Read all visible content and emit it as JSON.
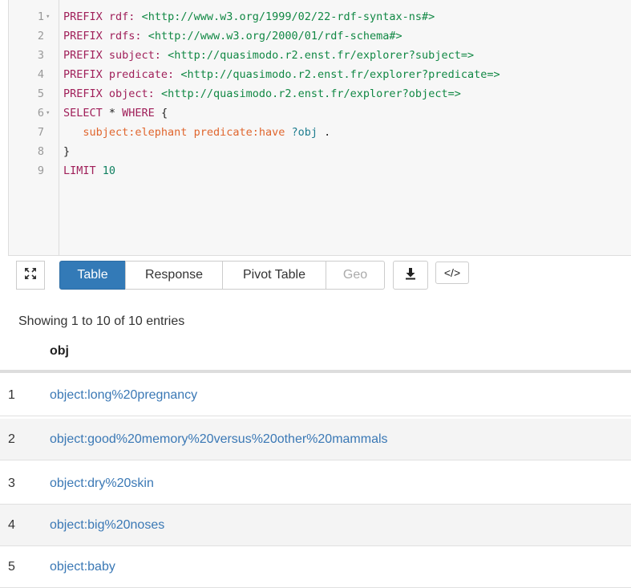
{
  "editor": {
    "lines": [
      {
        "n": "1",
        "fold": true,
        "parts": [
          [
            "kw",
            "PREFIX "
          ],
          [
            "pfx",
            "rdf:"
          ],
          [
            "br",
            " "
          ],
          [
            "iri",
            "<http://www.w3.org/1999/02/22-rdf-syntax-ns#>"
          ]
        ]
      },
      {
        "n": "2",
        "fold": false,
        "parts": [
          [
            "kw",
            "PREFIX "
          ],
          [
            "pfx",
            "rdfs:"
          ],
          [
            "br",
            " "
          ],
          [
            "iri",
            "<http://www.w3.org/2000/01/rdf-schema#>"
          ]
        ]
      },
      {
        "n": "3",
        "fold": false,
        "parts": [
          [
            "kw",
            "PREFIX "
          ],
          [
            "pfx",
            "subject:"
          ],
          [
            "br",
            " "
          ],
          [
            "iri",
            "<http://quasimodo.r2.enst.fr/explorer?subject=>"
          ]
        ]
      },
      {
        "n": "4",
        "fold": false,
        "parts": [
          [
            "kw",
            "PREFIX "
          ],
          [
            "pfx",
            "predicate:"
          ],
          [
            "br",
            " "
          ],
          [
            "iri",
            "<http://quasimodo.r2.enst.fr/explorer?predicate=>"
          ]
        ]
      },
      {
        "n": "5",
        "fold": false,
        "parts": [
          [
            "kw",
            "PREFIX "
          ],
          [
            "pfx",
            "object:"
          ],
          [
            "br",
            " "
          ],
          [
            "iri",
            "<http://quasimodo.r2.enst.fr/explorer?object=>"
          ]
        ]
      },
      {
        "n": "6",
        "fold": true,
        "parts": [
          [
            "kw",
            "SELECT "
          ],
          [
            "br",
            "* "
          ],
          [
            "kw",
            "WHERE "
          ],
          [
            "br",
            "{"
          ]
        ]
      },
      {
        "n": "7",
        "fold": false,
        "parts": [
          [
            "br",
            "   "
          ],
          [
            "name",
            "subject:elephant"
          ],
          [
            "br",
            " "
          ],
          [
            "name",
            "predicate:have"
          ],
          [
            "br",
            " "
          ],
          [
            "var",
            "?obj"
          ],
          [
            "br",
            " ."
          ]
        ]
      },
      {
        "n": "8",
        "fold": false,
        "parts": [
          [
            "br",
            "}"
          ]
        ]
      },
      {
        "n": "9",
        "fold": false,
        "parts": [
          [
            "kw",
            "LIMIT "
          ],
          [
            "num",
            "10"
          ]
        ]
      }
    ]
  },
  "toolbar": {
    "expand_icon": "expand-icon",
    "tabs": [
      {
        "id": "table",
        "label": "Table",
        "active": true,
        "disabled": false
      },
      {
        "id": "response",
        "label": "Response",
        "active": false,
        "disabled": false
      },
      {
        "id": "pivot",
        "label": "Pivot Table",
        "active": false,
        "disabled": false
      },
      {
        "id": "geo",
        "label": "Geo",
        "active": false,
        "disabled": true
      }
    ],
    "download_icon": "download-icon",
    "embed_label": "</>"
  },
  "results": {
    "status": "Showing 1 to 10 of 10 entries",
    "header": "obj",
    "rows": [
      {
        "index": "1",
        "value": "object:long%20pregnancy"
      },
      {
        "index": "2",
        "value": "object:good%20memory%20versus%20other%20mammals"
      },
      {
        "index": "3",
        "value": "object:dry%20skin"
      },
      {
        "index": "4",
        "value": "object:big%20noses"
      },
      {
        "index": "5",
        "value": "object:baby"
      }
    ]
  },
  "colors": {
    "accent": "#337ab7",
    "link": "#3a78b5",
    "keyword": "#a0205a",
    "prefixed_name": "#e0662e",
    "iri": "#118844",
    "variable": "#1e7d8f"
  }
}
